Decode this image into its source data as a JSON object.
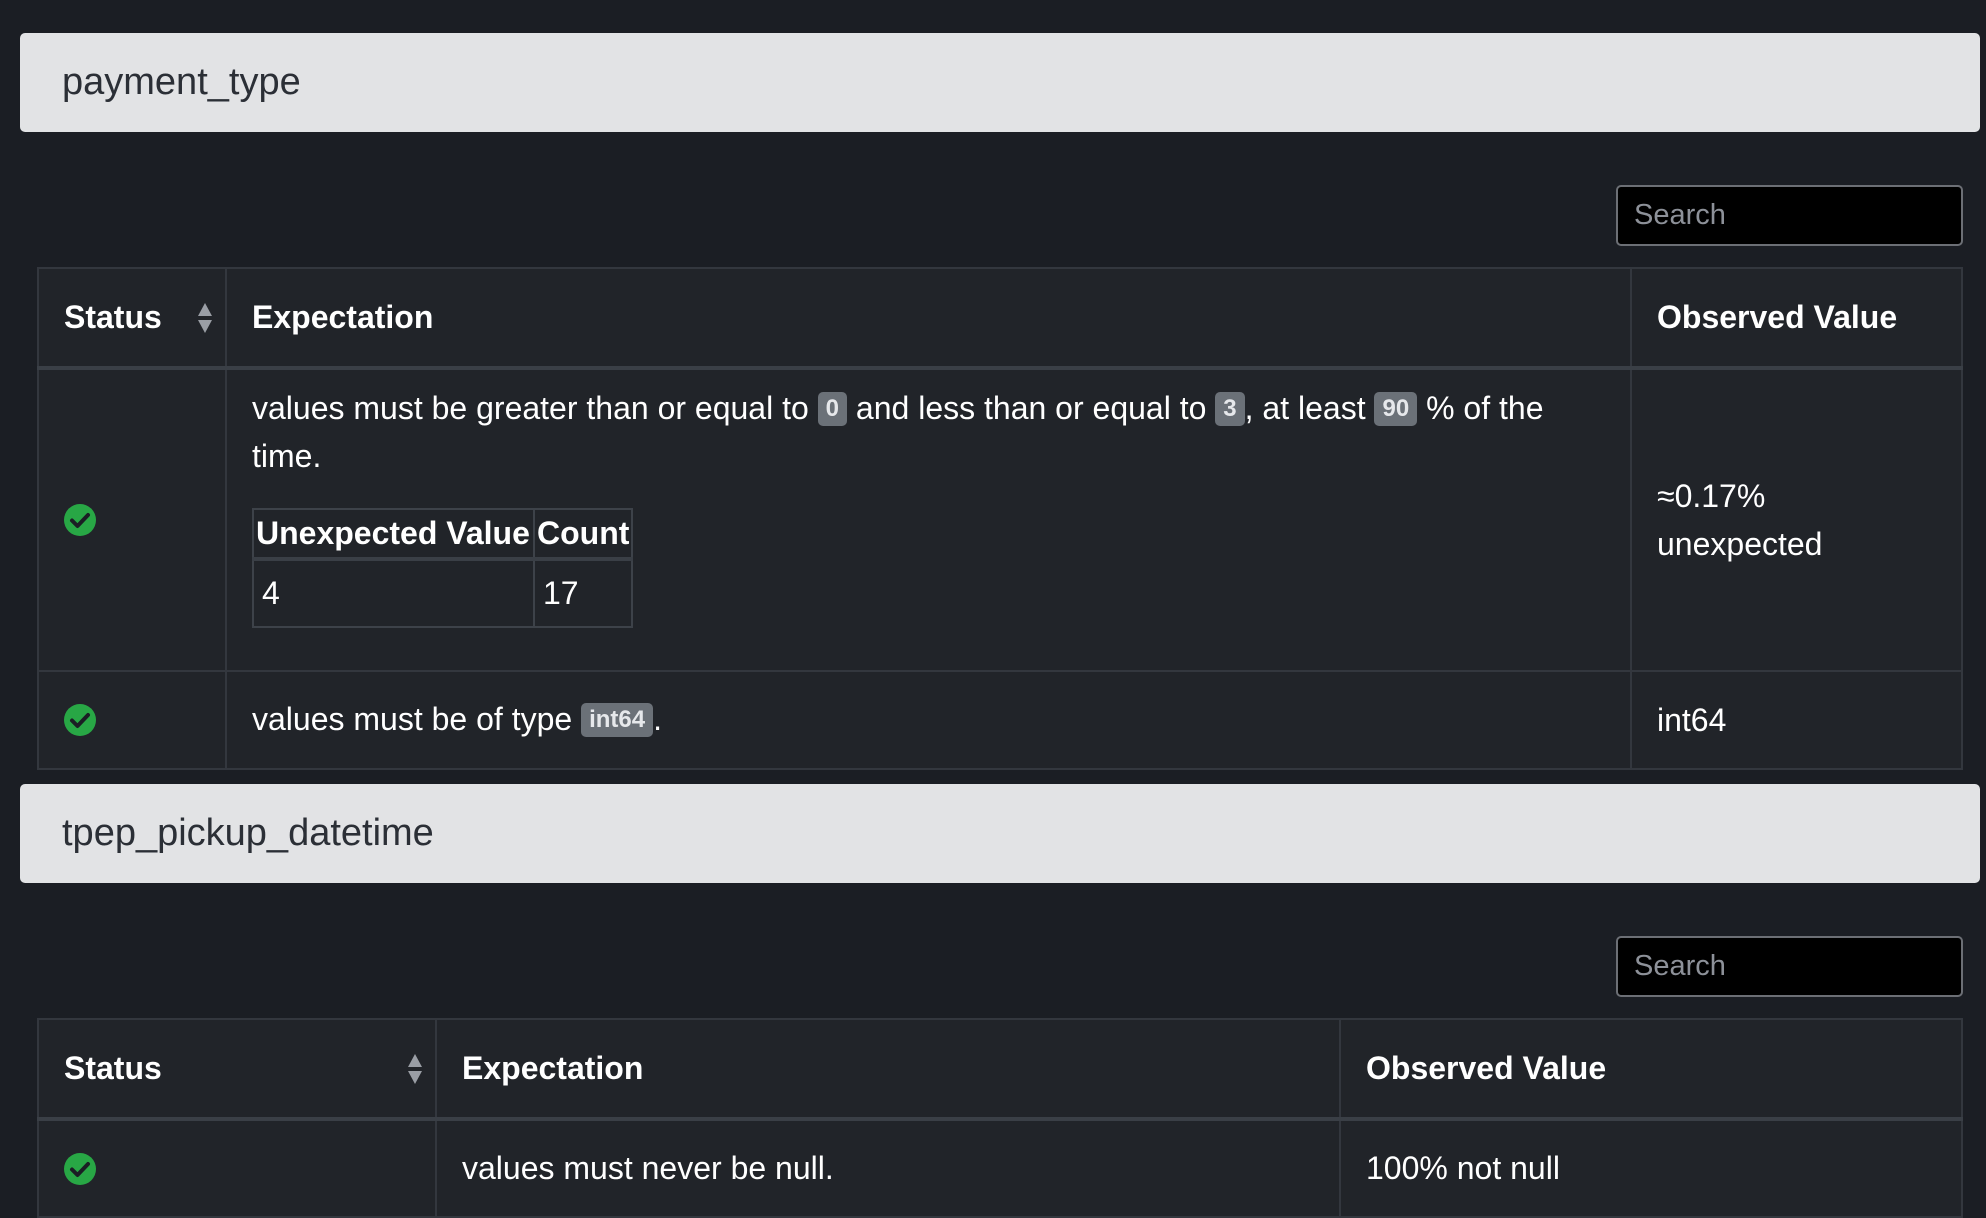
{
  "sections": [
    {
      "title": "payment_type",
      "search_placeholder": "Search",
      "columns": [
        "Status",
        "Expectation",
        "Observed Value"
      ],
      "rows": [
        {
          "status": "success",
          "expectation": {
            "t1": "values must be greater than or equal to ",
            "min": "0",
            "t2": " and less than or equal to ",
            "max": "3",
            "t3": ", at least ",
            "mostly": "90",
            "t4": " % of the time."
          },
          "unexpected_table": {
            "headers": [
              "Unexpected Value",
              "Count"
            ],
            "rows": [
              [
                "4",
                "17"
              ]
            ]
          },
          "observed": {
            "line1": "≈0.17%",
            "line2": "unexpected"
          }
        },
        {
          "status": "success",
          "expectation": {
            "t1": "values must be of type ",
            "type": "int64",
            "t2": "."
          },
          "observed": "int64"
        }
      ]
    },
    {
      "title": "tpep_pickup_datetime",
      "search_placeholder": "Search",
      "columns": [
        "Status",
        "Expectation",
        "Observed Value"
      ],
      "rows": [
        {
          "status": "success",
          "expectation": "values must never be null.",
          "observed": "100% not null"
        }
      ]
    }
  ],
  "colors": {
    "success": "#28a745",
    "header_bg": "#e2e3e5",
    "page_bg": "#1b1e24",
    "table_bg": "#212429"
  },
  "icons": {
    "status": "check-circle-icon",
    "sort": "sort-icon"
  }
}
